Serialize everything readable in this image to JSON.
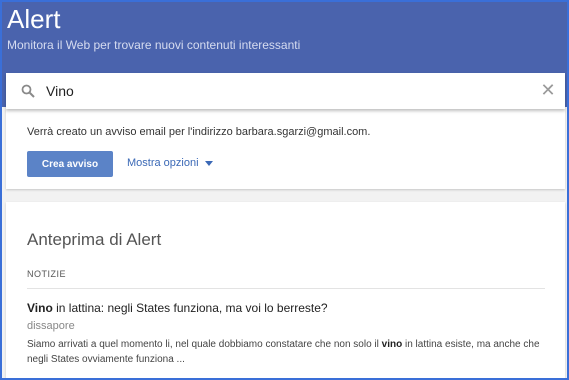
{
  "header": {
    "title": "Alert",
    "subtitle": "Monitora il Web per trovare nuovi contenuti interessanti"
  },
  "search": {
    "value": "Vino",
    "clear_icon": "close-icon",
    "search_icon": "search-icon"
  },
  "create_card": {
    "email_note": "Verrà creato un avviso email per l'indirizzo barbara.sgarzi@gmail.com.",
    "create_button": "Crea avviso",
    "options_link": "Mostra opzioni"
  },
  "preview": {
    "title": "Anteprima di Alert",
    "section_label": "NOTIZIE",
    "result": {
      "title_bold": "Vino",
      "title_rest": " in lattina: negli States funziona, ma voi lo berreste?",
      "source": "dissapore",
      "snippet_before": "Siamo arrivati a quel momento li, nel quale dobbiamo constatare che non solo il ",
      "snippet_bold": "vino",
      "snippet_after": " in lattina esiste, ma anche che negli States ovviamente funziona ..."
    }
  },
  "colors": {
    "header_bg": "#4a63ad",
    "button_bg": "#5b83c7",
    "link": "#3b69b6",
    "frame": "#3a6fd8"
  }
}
